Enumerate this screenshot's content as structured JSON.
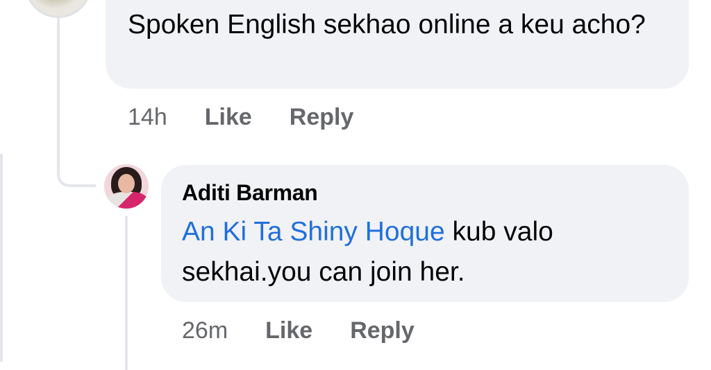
{
  "parent_comment": {
    "text": "Spoken English sekhao online a keu acho?",
    "time": "14h",
    "like_label": "Like",
    "reply_label": "Reply"
  },
  "reply_comment": {
    "author": "Aditi Barman",
    "mention": "An Ki Ta Shiny Hoque",
    "text_after_mention": " kub valo sekhai.you can join her.",
    "time": "26m",
    "like_label": "Like",
    "reply_label": "Reply"
  },
  "colors": {
    "bubble": "#f0f2f5",
    "mention": "#216fdb",
    "meta": "#65676b",
    "thread_line": "#e4e6eb"
  }
}
